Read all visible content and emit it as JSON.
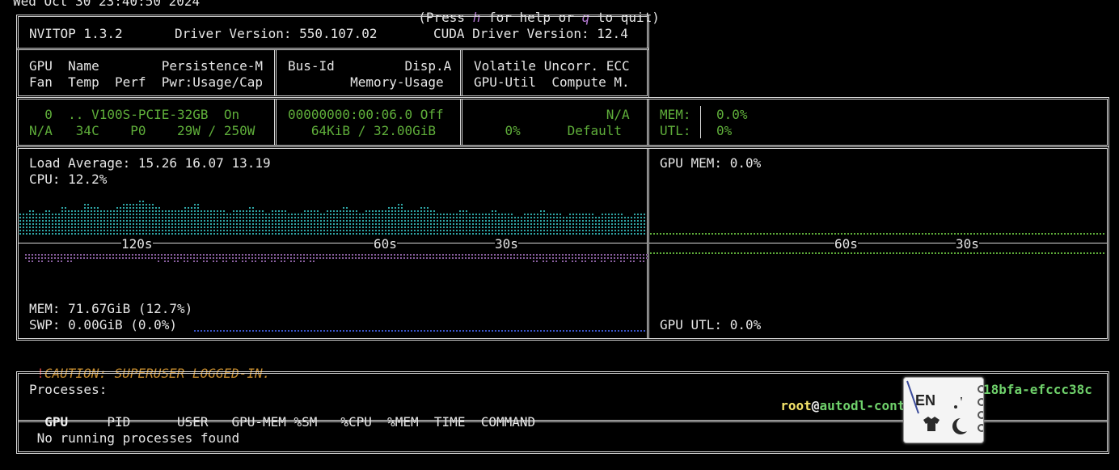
{
  "top": {
    "datetime": "Wed Oct 30 23:40:50 2024",
    "help_prefix": "(Press ",
    "help_h": "h",
    "help_mid": " for help or ",
    "help_q": "q",
    "help_suffix": " to quit)"
  },
  "header": {
    "nvitop": "NVITOP 1.3.2",
    "driver": "Driver Version: 550.107.02",
    "cuda": "CUDA Driver Version: 12.4"
  },
  "columns": {
    "c1_l1": "GPU  Name        Persistence-M",
    "c1_l2": "Fan  Temp  Perf  Pwr:Usage/Cap",
    "c2_l1": "Bus-Id         Disp.A",
    "c2_l2": "        Memory-Usage",
    "c3_l1": "Volatile Uncorr. ECC",
    "c3_l2": "GPU-Util  Compute M."
  },
  "gpu": {
    "row1_c1": "  0  .. V100S-PCIE-32GB  On",
    "row2_c1": "N/A   34C    P0    29W / 250W",
    "row1_c2": "00000000:00:06.0 Off",
    "row2_c2": "   64KiB / 32.00GiB",
    "row1_c3": "                 N/A",
    "row2_c3": "    0%      Default",
    "mem_label": "MEM:",
    "mem_value": "0.0%",
    "utl_label": "UTL:",
    "utl_value": "0%"
  },
  "host": {
    "load_avg": "Load Average: 15.26 16.07 13.19",
    "cpu": "CPU: 12.2%",
    "mem": "MEM: 71.67GiB (12.7%)",
    "swp": "SWP: 0.00GiB (0.0%)",
    "t120": "120s",
    "t60": "60s",
    "t30": "30s",
    "gpu_mem": "GPU MEM: 0.0%",
    "gpu_utl": "GPU UTL: 0.0%",
    "g60": "60s",
    "g30": "30s",
    "cpu_history_pct": [
      12,
      13,
      11,
      14,
      12,
      15,
      13,
      14,
      16,
      15,
      14,
      13,
      15,
      16,
      17,
      18,
      16,
      15,
      14,
      13,
      14,
      15,
      16,
      14,
      13,
      14,
      12,
      13,
      14,
      15,
      13,
      12,
      14,
      13,
      12,
      11,
      13,
      14,
      12,
      13,
      14,
      15,
      13,
      12,
      14,
      13,
      14,
      15,
      16,
      14,
      13,
      15,
      14,
      12,
      11,
      12,
      13,
      12,
      11,
      12,
      13,
      12,
      11,
      10,
      11,
      12,
      13,
      12,
      11,
      10,
      11,
      12,
      11,
      10,
      11,
      12,
      11,
      10,
      11,
      12
    ],
    "gpu_mem_history_pct": [
      0,
      0,
      0,
      0,
      0,
      0,
      0,
      0,
      0,
      0,
      0,
      0,
      0,
      0,
      0,
      0,
      0,
      0,
      0,
      0,
      0,
      0,
      0,
      0,
      0,
      0,
      0,
      0,
      0,
      0,
      0,
      0,
      0,
      0,
      0,
      0,
      0,
      0,
      0,
      0,
      0,
      0,
      0,
      0,
      0,
      0,
      0,
      0,
      0,
      0,
      0,
      0,
      0,
      0,
      0,
      0
    ],
    "gpu_utl_history_pct": [
      0,
      0,
      0,
      0,
      0,
      0,
      0,
      0,
      0,
      0,
      0,
      0,
      0,
      0,
      0,
      0,
      0,
      0,
      0,
      0,
      0,
      0,
      0,
      0,
      0,
      0,
      0,
      0,
      0,
      0,
      0,
      0,
      0,
      0,
      0,
      0,
      0,
      0,
      0,
      0,
      0,
      0,
      0,
      0,
      0,
      0,
      0,
      0,
      0,
      0,
      0,
      0,
      0,
      0,
      0,
      0
    ]
  },
  "caution": {
    "bang": "!",
    "text": "CAUTION: SUPERUSER LOGGED-IN."
  },
  "processes": {
    "title": "Processes:",
    "user": "root",
    "at": "@",
    "host_left": "autodl-conta",
    "host_right": "18bfa-efccc38c",
    "col_gpu": "GPU",
    "col_rest": "     PID      USER   GPU-MEM %SM   %CPU  %MEM  TIME  COMMAND",
    "empty": " No running processes found"
  },
  "ime": {
    "label": "EN"
  },
  "colors": {
    "gpu_green": "#5fae3a",
    "cpu_teal": "#2fa7a7",
    "mem_purple": "#8a5fa0",
    "swap_blue": "#3a55c8",
    "caution_orange": "#c68c2e"
  }
}
